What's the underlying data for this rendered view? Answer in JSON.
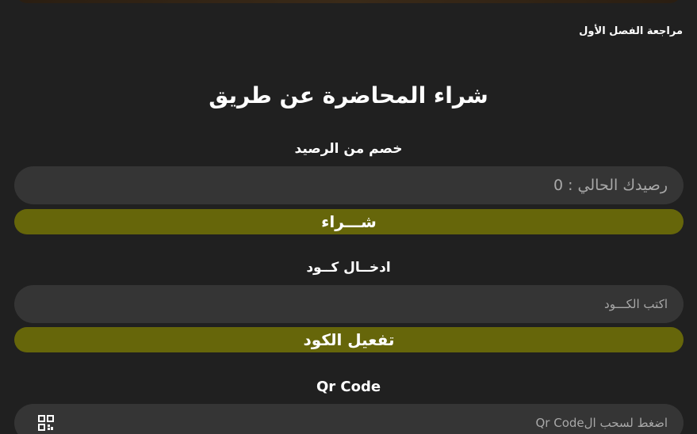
{
  "breadcrumb": "مراجعة الفصل الأول",
  "title": "شراء المحاضرة عن طريق",
  "balance_section": {
    "label": "خصم من الرصيد",
    "balance_text": "رصيدك الحالي : 0",
    "buy_button": "شـــراء"
  },
  "code_section": {
    "label": "ادخــال كــود",
    "placeholder": "اكتب الكـــود",
    "activate_button": "تفعيل الكود"
  },
  "qr_section": {
    "label": "Qr Code",
    "scan_text": "اضغط لسحب الQr Code",
    "icon": "qr-code-icon"
  },
  "colors": {
    "background": "#202020",
    "field": "#353535",
    "button": "#66660a",
    "text": "#ffffff",
    "muted_text": "#a8a8a8"
  }
}
